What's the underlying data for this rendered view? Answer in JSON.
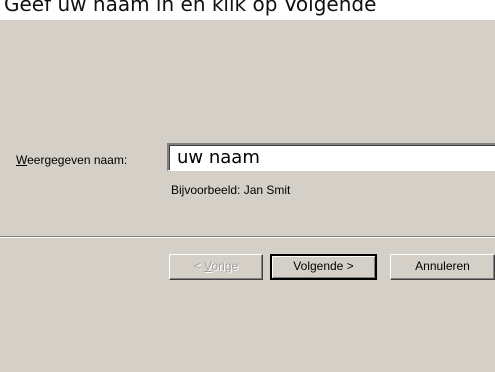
{
  "caption": "Geef uw naam in en klik op Volgende",
  "form": {
    "label_accel": "W",
    "label_rest": "eergegeven naam:",
    "input_value": "uw naam",
    "example": "Bijvoorbeeld: Jan Smit"
  },
  "buttons": {
    "back_lt": "< ",
    "back_accel": "V",
    "back_rest": "orige",
    "next": "Volgende >",
    "cancel": "Annuleren"
  }
}
